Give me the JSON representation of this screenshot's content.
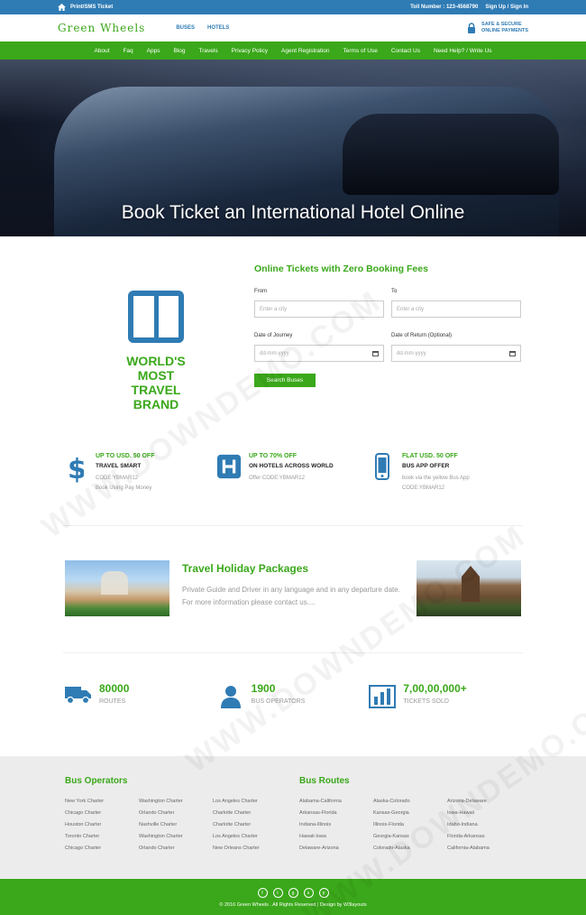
{
  "topbar": {
    "print_label": "Print/SMS Ticket",
    "toll": "Toll Number : 123-4568790",
    "signin": "Sign Up / Sign In"
  },
  "header": {
    "logo": "Green Wheels",
    "nav": [
      "BUSES",
      "HOTELS"
    ],
    "safe_line1": "SAFE & SECURE",
    "safe_line2": "ONLINE PAYMENTS"
  },
  "mainnav": [
    "About",
    "Faq",
    "Apps",
    "Blog",
    "Travels",
    "Privacy Policy",
    "Agent Registration",
    "Terms of Use",
    "Contact Us",
    "Need Help? / Write Us"
  ],
  "hero": {
    "title": "Book Ticket an International Hotel Online"
  },
  "brand": {
    "line1": "WORLD'S MOST",
    "line2": "TRAVEL BRAND"
  },
  "form": {
    "title": "Online Tickets with Zero Booking Fees",
    "from_label": "From",
    "to_label": "To",
    "from_placeholder": "Enter a city",
    "to_placeholder": "Enter a city",
    "journey_label": "Date of Journey",
    "return_label": "Date of Return (Optional)",
    "date_placeholder": "dd-mm-yyyy",
    "search_label": "Search Buses"
  },
  "offers": [
    {
      "icon": "dollar-icon",
      "t1": "UP TO USD. 50 OFF",
      "t2": "TRAVEL SMART",
      "t3a": "CODE:YBMAR12",
      "t3b": "Book Using Pay Money"
    },
    {
      "icon": "hotel-icon",
      "t1": "UP TO 70% OFF",
      "t2": "ON HOTELS ACROSS WORLD",
      "t3a": "Offer CODE:YBMAR12",
      "t3b": ""
    },
    {
      "icon": "phone-icon",
      "t1": "FLAT USD. 50 OFF",
      "t2": "BUS APP OFFER",
      "t3a": "book via the yellow Bus App",
      "t3b": "CODE:YBMAR12"
    }
  ],
  "holiday": {
    "title": "Travel Holiday Packages",
    "text": "Private Guide and Driver in any language and in any departure date. For more information please contact us...."
  },
  "stats": [
    {
      "icon": "truck-icon",
      "num": "80000",
      "label": "ROUTES"
    },
    {
      "icon": "user-icon",
      "num": "1900",
      "label": "BUS OPERATORS"
    },
    {
      "icon": "bar-chart-icon",
      "num": "7,00,00,000+",
      "label": "TICKETS SOLD"
    }
  ],
  "bus_operators": {
    "title": "Bus Operators",
    "cols": [
      [
        "New York Charter",
        "Chicago Charter",
        "Houston Charter",
        "Toronto Charter",
        "Chicago Charter"
      ],
      [
        "Washington Charter",
        "Orlando Charter",
        "Nashville Charter",
        "Washington Charter",
        "Orlando Charter"
      ],
      [
        "Los Angeles Charter",
        "Charlotte Charter",
        "Charlotte Charter",
        "Los Angeles Charter",
        "New Orleans Charter"
      ]
    ]
  },
  "bus_routes": {
    "title": "Bus Routes",
    "cols": [
      [
        "Alabama-California",
        "Arkansas-Florida",
        "Indiana-Illinois",
        "Hawaii-Iowa",
        "Delaware-Arizona"
      ],
      [
        "Alaska-Colorado",
        "Kansas-Georgia",
        "Illinois-Florida",
        "Georgia-Kansas",
        "Colorado-Alaska"
      ],
      [
        "Arizona-Delaware",
        "Iowa-Hawaii",
        "Idaho-Indiana",
        "Florida-Arkansas",
        "California-Alabama"
      ]
    ]
  },
  "footer": {
    "socials": [
      "f",
      "t",
      "g",
      "s",
      "p"
    ],
    "copy": "© 2016 Green Wheels . All Rights Reserved | Design by W3layouts"
  },
  "watermark": "WWW.DOWNDEMO.COM",
  "colors": {
    "green": "#3aa81a",
    "blue": "#2f7bb4"
  }
}
